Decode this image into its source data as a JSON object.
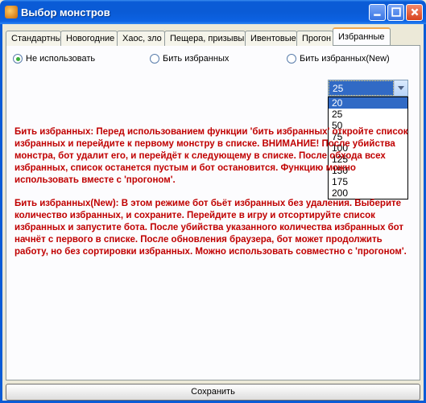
{
  "window": {
    "title": "Выбор монстров"
  },
  "tabs": {
    "t0": "Стандартные",
    "t1": "Новогодние",
    "t2": "Хаос, зло",
    "t3": "Пещера, призывы",
    "t4": "Ивентовые",
    "t5": "Прогон",
    "t6": "Избранные"
  },
  "radios": {
    "r1": "Не использовать",
    "r2": "Бить избранных",
    "r3": "Бить избранных(New)"
  },
  "combo": {
    "value": "25",
    "options": [
      "20",
      "25",
      "50",
      "75",
      "100",
      "125",
      "150",
      "175",
      "200"
    ],
    "selected_option": "20"
  },
  "desc": {
    "p1": "Бить избранных: Перед использованием функции 'бить избранных' откройте список избранных и перейдите к первому монстру в списке. ВНИМАНИЕ! После убийства монстра, бот удалит его, и перейдёт к следующему в списке. После обхода всех избранных, список останется пустым и бот остановится. Функцию можно использовать вместе с 'прогоном'.",
    "p2": "Бить избранных(New): В этом режиме бот бьёт избранных без удаления. Выберите количество избранных, и сохраните. Перейдите в игру и отсортируйте список избранных и запустите бота. После убийства указанного количества избранных бот начнёт с первого в списке. После обновления браузера, бот может продолжить работу, но без сортировки избранных. Можно использовать совместно с 'прогоном'."
  },
  "buttons": {
    "save": "Сохранить"
  }
}
